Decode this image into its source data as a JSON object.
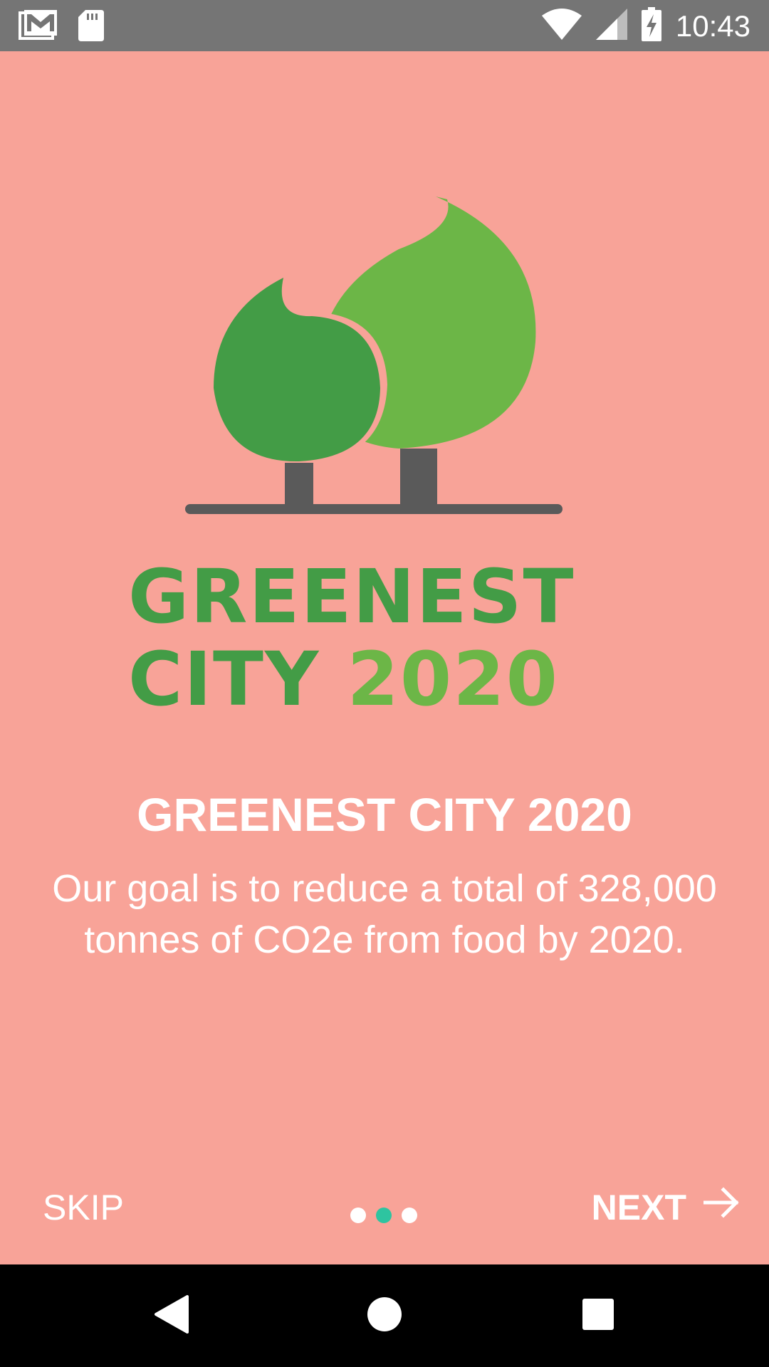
{
  "status_bar": {
    "time": "10:43",
    "icons": [
      "gmail-icon",
      "sd-card-icon",
      "wifi-icon",
      "cell-signal-icon",
      "battery-charging-icon"
    ]
  },
  "logo": {
    "line1": "GREENEST",
    "line2_word": "CITY",
    "line2_year": "2020",
    "colors": {
      "dark_green": "#439C46",
      "light_green": "#6CB647",
      "trunk": "#5A5A5A"
    }
  },
  "slide": {
    "title": "GREENEST CITY 2020",
    "description": "Our goal is to reduce a total of 328,000 tonnes of CO2e from food by 2020."
  },
  "controls": {
    "skip_label": "SKIP",
    "next_label": "NEXT",
    "page_indicator": {
      "total": 3,
      "current": 2
    }
  },
  "colors": {
    "background": "#F8A398",
    "status_bar": "#757575",
    "active_dot": "#2EC4A0",
    "text": "#FFFFFF"
  },
  "nav_bar": {
    "buttons": [
      "back-icon",
      "home-icon",
      "recents-icon"
    ]
  }
}
